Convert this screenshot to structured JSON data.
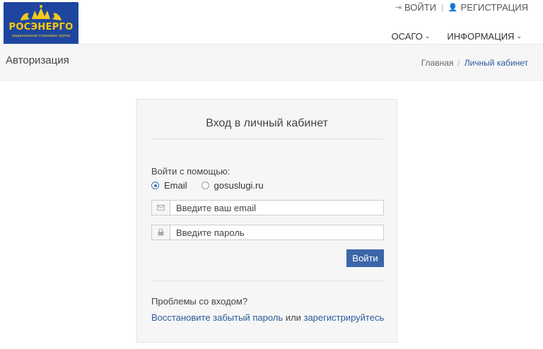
{
  "header": {
    "logo": {
      "text": "РОСЭНЕРГО",
      "subtitle": "национальная страховая группа",
      "bg_color": "#1e46a0",
      "accent_color": "#f2c81b"
    },
    "top_links": [
      {
        "label": "ВОЙТИ",
        "icon": "sign-in-icon"
      },
      {
        "label": "РЕГИСТРАЦИЯ",
        "icon": "user-plus-icon"
      }
    ],
    "separator": "|",
    "nav": [
      {
        "label": "ОСАГО",
        "icon": "chevron-down-icon"
      },
      {
        "label": "ИНФОРМАЦИЯ",
        "icon": "chevron-down-icon"
      }
    ]
  },
  "titlebar": {
    "title": "Авторизация",
    "breadcrumb": {
      "home": "Главная",
      "separator": "/",
      "current": "Личный кабинет"
    }
  },
  "login": {
    "title": "Вход в личный кабинет",
    "login_with": "Войти с помощью:",
    "options": [
      {
        "label": "Email",
        "selected": true
      },
      {
        "label": "gosuslugi.ru",
        "selected": false
      }
    ],
    "email_placeholder": "Введите ваш email",
    "password_placeholder": "Введите пароль",
    "email_icon": "envelope-icon",
    "password_icon": "lock-icon",
    "submit_label": "Войти",
    "problems": "Проблемы со входом?",
    "recover_link": "Восстановите забытый пароль",
    "or_text": "или",
    "register_link": "зарегистрируйтесь"
  },
  "colors": {
    "link": "#2a5a9a",
    "button": "#3c66a8",
    "radio_active": "#3a6fc2"
  }
}
